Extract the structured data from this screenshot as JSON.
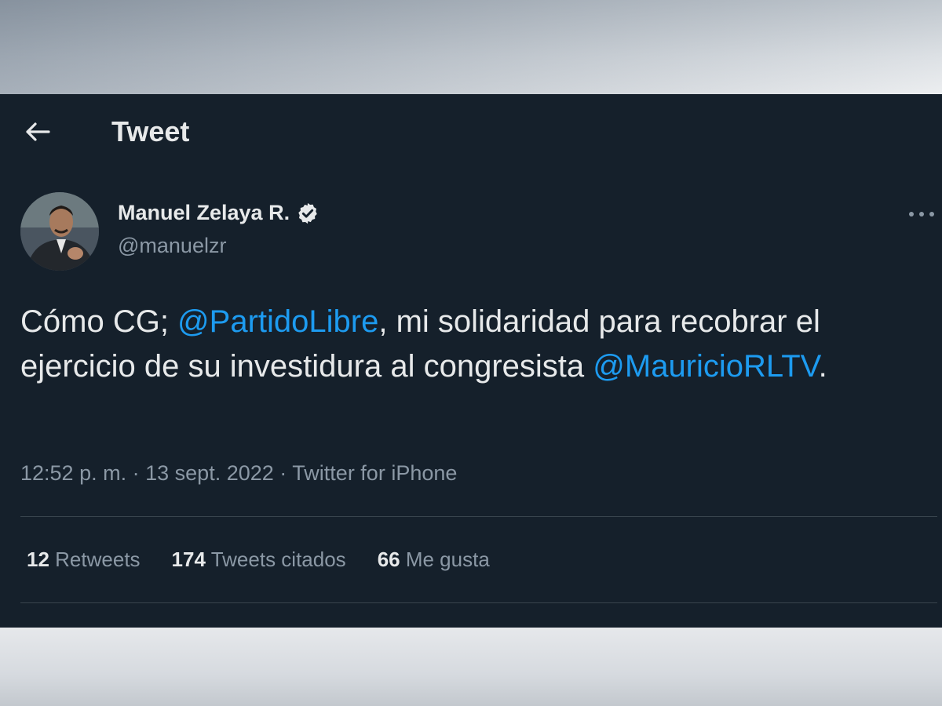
{
  "header": {
    "title": "Tweet"
  },
  "author": {
    "name": "Manuel Zelaya R.",
    "handle": "@manuelzr"
  },
  "tweet": {
    "text_1": "Cómo CG; ",
    "mention_1": "@PartidoLibre",
    "text_2": ", mi solidaridad para recobrar el ejercicio de su investidura al congresista ",
    "mention_2": "@MauricioRLTV",
    "text_3": "."
  },
  "meta": {
    "time": "12:52 p. m.",
    "sep": "·",
    "date": "13 sept. 2022",
    "source": "Twitter for iPhone"
  },
  "stats": [
    {
      "count": "12",
      "label": "Retweets"
    },
    {
      "count": "174",
      "label": "Tweets citados"
    },
    {
      "count": "66",
      "label": "Me gusta"
    }
  ],
  "colors": {
    "background": "#15202b",
    "text": "#e7e9ea",
    "secondary": "#8b98a5",
    "link": "#1d9bf0",
    "divider": "#38444d"
  },
  "icons": {
    "back": "arrow-left-icon",
    "verified": "verified-badge-icon",
    "more": "more-horizontal-icon"
  }
}
